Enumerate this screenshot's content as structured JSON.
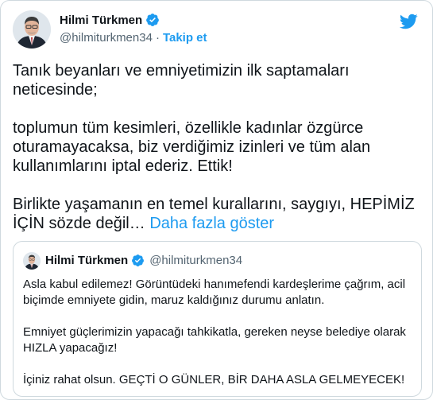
{
  "author": {
    "display_name": "Hilmi Türkmen",
    "handle": "@hilmiturkmen34",
    "separator": "·",
    "follow_label": "Takip et"
  },
  "icons": {
    "verified": "verified-badge-icon",
    "twitter": "twitter-bird-icon",
    "brand_color": "#1d9bf0"
  },
  "tweet": {
    "line1": "Tanık beyanları ve emniyetimizin ilk saptamaları",
    "line2": "neticesinde;",
    "line3": "toplumun tüm kesimleri, özellikle kadınlar özgürce",
    "line4": "oturamayacaksa, biz verdiğimiz izinleri ve tüm alan",
    "line5": "kullanımlarını iptal ederiz. Ettik!",
    "line6": "Birlikte yaşamanın en temel kurallarını, saygıyı, HEPİMİZ",
    "line7": "İÇİN sözde değil…",
    "show_more": "Daha fazla göster"
  },
  "quoted": {
    "display_name": "Hilmi Türkmen",
    "handle": "@hilmiturkmen34",
    "line1": "Asla kabul edilemez! Görüntüdeki hanımefendi kardeşlerime çağrım, acil",
    "line2": "biçimde emniyete gidin, maruz kaldığınız durumu anlatın.",
    "line3": "Emniyet güçlerimizin yapacağı tahkikatla, gereken neyse belediye olarak",
    "line4": "HIZLA yapacağız!",
    "line5": "İçiniz rahat olsun. GEÇTİ O GÜNLER, BİR DAHA ASLA GELMEYECEK!"
  }
}
